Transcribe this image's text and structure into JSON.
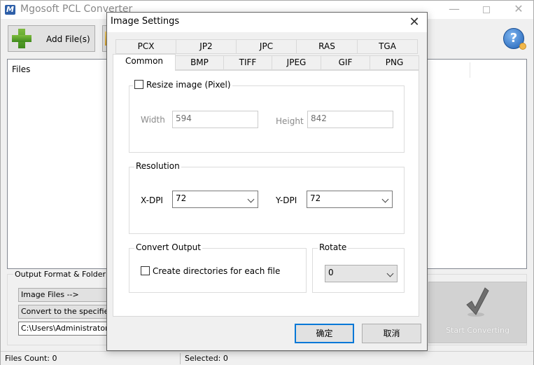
{
  "app": {
    "title": "Mgosoft PCL Converter",
    "logo_letter": "M",
    "window_controls": {
      "minimize": "—",
      "close": "✕"
    }
  },
  "toolbar": {
    "add_files_label": "Add File(s)",
    "help_symbol": "?"
  },
  "files_panel": {
    "header": "Files"
  },
  "output": {
    "legend": "Output Format & Folder",
    "format_value": "Image Files -->",
    "folder_mode_value": "Convert to the specified di",
    "folder_path": "C:\\Users\\Administrator\\My"
  },
  "start_button": {
    "label": "Start Converting"
  },
  "status": {
    "files_count": "Files Count: 0",
    "selected": "Selected: 0"
  },
  "dialog": {
    "title": "Image Settings",
    "close_symbol": "✕",
    "tabs_row1": [
      "PCX",
      "JP2",
      "JPC",
      "RAS",
      "TGA"
    ],
    "tabs_row2": [
      "Common",
      "BMP",
      "TIFF",
      "JPEG",
      "GIF",
      "PNG"
    ],
    "active_tab": "Common",
    "resize": {
      "label": "Resize image (Pixel)",
      "checked": false,
      "width_label": "Width",
      "width_value": "594",
      "height_label": "Height",
      "height_value": "842"
    },
    "resolution": {
      "legend": "Resolution",
      "xdpi_label": "X-DPI",
      "xdpi_value": "72",
      "ydpi_label": "Y-DPI",
      "ydpi_value": "72"
    },
    "convert_output": {
      "legend": "Convert Output",
      "create_dirs_label": "Create directories for each file",
      "checked": false
    },
    "rotate": {
      "legend": "Rotate",
      "value": "0"
    },
    "ok_label": "确定",
    "cancel_label": "取消"
  },
  "colors": {
    "accent": "#0078d7",
    "help_blue": "#1d5fb5",
    "add_green": "#3e8a1c"
  }
}
